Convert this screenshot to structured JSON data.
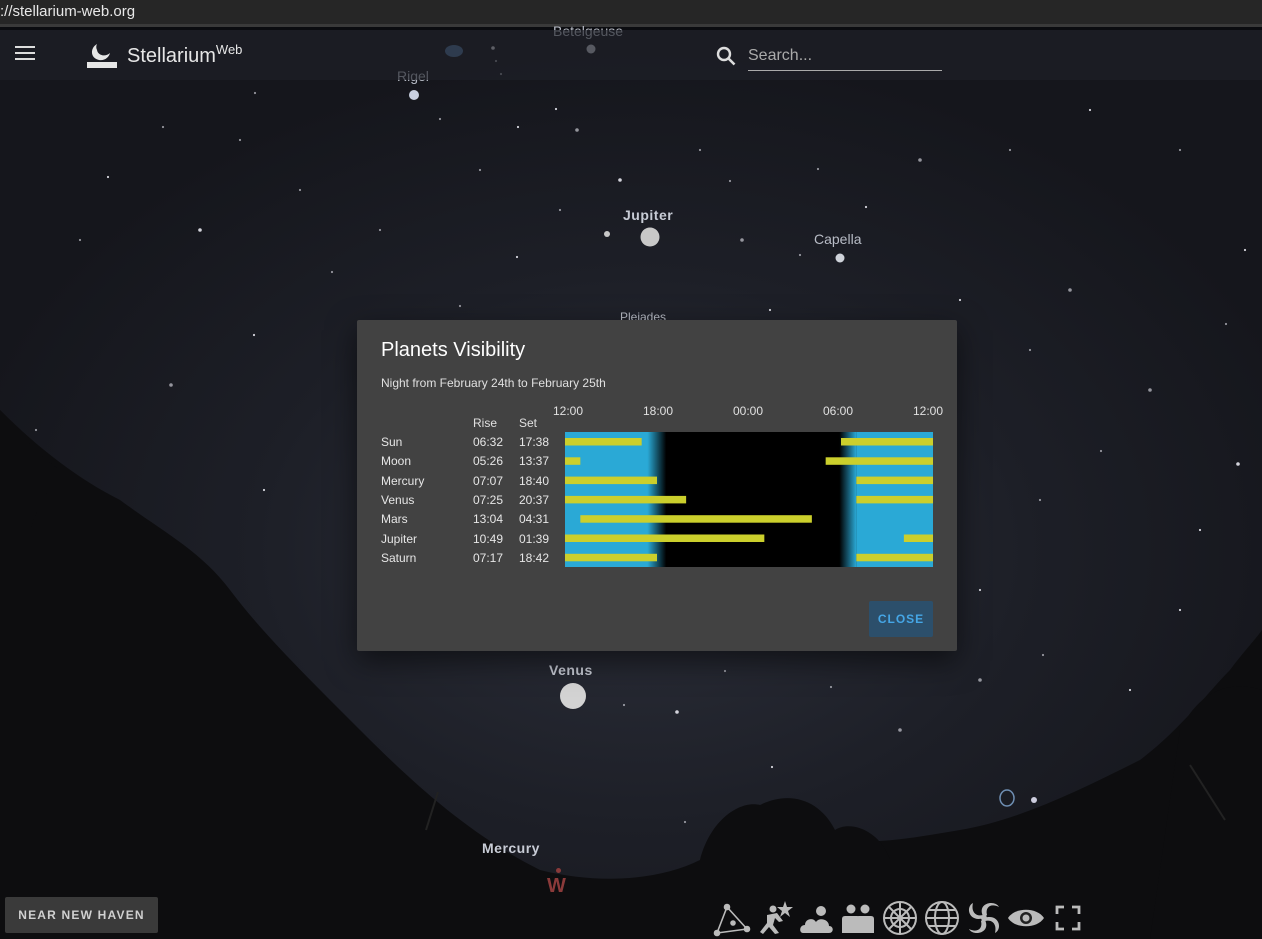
{
  "browser": {
    "url": "://stellarium-web.org"
  },
  "topbar": {
    "brand": "Stellarium",
    "brand_sup": "Web",
    "search_placeholder": "Search..."
  },
  "sky_labels": {
    "betelgeuse": "Betelgeuse",
    "rigel": "Rigel",
    "jupiter": "Jupiter",
    "capella": "Capella",
    "pleiades": "Pleiades",
    "venus": "Venus",
    "mercury": "Mercury",
    "west": "W"
  },
  "dialog": {
    "title": "Planets Visibility",
    "subtitle": "Night from February 24th to February 25th",
    "col_rise": "Rise",
    "col_set": "Set",
    "time_ticks": [
      "12:00",
      "18:00",
      "00:00",
      "06:00",
      "12:00"
    ],
    "close_label": "CLOSE",
    "rows": [
      {
        "name": "Sun",
        "rise": "06:32",
        "set": "17:38"
      },
      {
        "name": "Moon",
        "rise": "05:26",
        "set": "13:37"
      },
      {
        "name": "Mercury",
        "rise": "07:07",
        "set": "18:40"
      },
      {
        "name": "Venus",
        "rise": "07:25",
        "set": "20:37"
      },
      {
        "name": "Mars",
        "rise": "13:04",
        "set": "04:31"
      },
      {
        "name": "Jupiter",
        "rise": "10:49",
        "set": "01:39"
      },
      {
        "name": "Saturn",
        "rise": "07:17",
        "set": "18:42"
      }
    ]
  },
  "chart_data": {
    "type": "bar",
    "x_range_hours": [
      12,
      36
    ],
    "twilight": {
      "dusk_start": 17.38,
      "dusk_end": 18.6,
      "dawn_start": 29.9,
      "dawn_end": 31.0
    },
    "day_color": "#2aa9d6",
    "bar_color": "#cbcf2c",
    "segments": [
      [
        [
          12.0,
          17.0
        ],
        [
          30.0,
          36.0
        ]
      ],
      [
        [
          12.0,
          13.0
        ],
        [
          29.0,
          36.0
        ]
      ],
      [
        [
          12.0,
          18.0
        ],
        [
          31.0,
          36.0
        ]
      ],
      [
        [
          12.0,
          19.9
        ],
        [
          31.0,
          36.0
        ]
      ],
      [
        [
          13.0,
          28.1
        ]
      ],
      [
        [
          12.0,
          25.0
        ],
        [
          34.1,
          36.0
        ]
      ],
      [
        [
          12.0,
          18.0
        ],
        [
          31.0,
          36.0
        ]
      ]
    ]
  },
  "location": {
    "label": "NEAR NEW HAVEN"
  },
  "toolbar": {
    "icons": [
      "constellation-lines-icon",
      "constellation-art-icon",
      "atmosphere-icon",
      "landscape-icon",
      "azimuthal-grid-icon",
      "equatorial-grid-icon",
      "nebulae-icon",
      "night-mode-icon",
      "fullscreen-icon"
    ]
  }
}
